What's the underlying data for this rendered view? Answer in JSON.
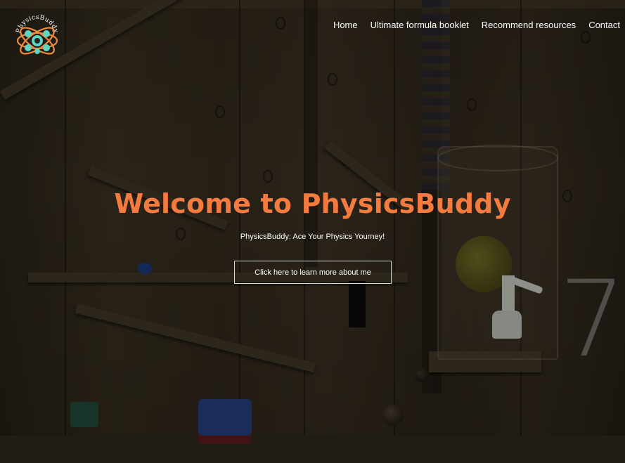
{
  "header": {
    "logo": {
      "text": "PhysicsBuddy",
      "icon": "atom-icon"
    },
    "nav": [
      {
        "label": "Home"
      },
      {
        "label": "Ultimate formula booklet"
      },
      {
        "label": "Recommend resources"
      },
      {
        "label": "Contact"
      }
    ]
  },
  "hero": {
    "title": "Welcome to PhysicsBuddy",
    "subtitle": "PhysicsBuddy: Ace Your Physics Yourney!",
    "button_label": "Click here to learn more about me",
    "background_text": "7"
  },
  "colors": {
    "title": "#f47b3f",
    "logo_teal": "#5fd4c1",
    "logo_orange": "#f08a3c",
    "nav_text": "#ffffff"
  }
}
